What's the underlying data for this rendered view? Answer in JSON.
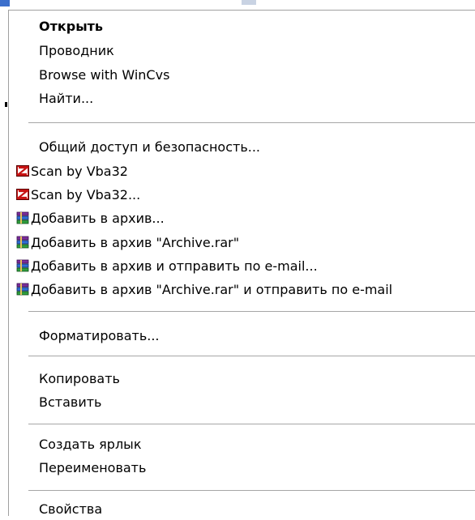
{
  "menu": {
    "items": [
      {
        "label": "Открыть",
        "bold": true
      },
      {
        "label": "Проводник"
      },
      {
        "label": "Browse with WinCvs"
      },
      {
        "label": "Найти..."
      },
      {
        "label": "Общий доступ и безопасность..."
      },
      {
        "label": "Scan by Vba32",
        "icon": "vba32-icon"
      },
      {
        "label": "Scan by Vba32...",
        "icon": "vba32-icon"
      },
      {
        "label": "Добавить в архив...",
        "icon": "winrar-icon"
      },
      {
        "label": "Добавить в архив \"Archive.rar\"",
        "icon": "winrar-icon"
      },
      {
        "label": "Добавить в архив и отправить по e-mail...",
        "icon": "winrar-icon"
      },
      {
        "label": "Добавить в архив \"Archive.rar\" и отправить по e-mail",
        "icon": "winrar-icon"
      },
      {
        "label": "Форматировать..."
      },
      {
        "label": "Копировать"
      },
      {
        "label": "Вставить"
      },
      {
        "label": "Создать ярлык"
      },
      {
        "label": "Переименовать"
      },
      {
        "label": "Свойства"
      }
    ]
  },
  "colors": {
    "menu_background": "#ffffff",
    "separator": "#a6a6a6",
    "text": "#000000"
  }
}
